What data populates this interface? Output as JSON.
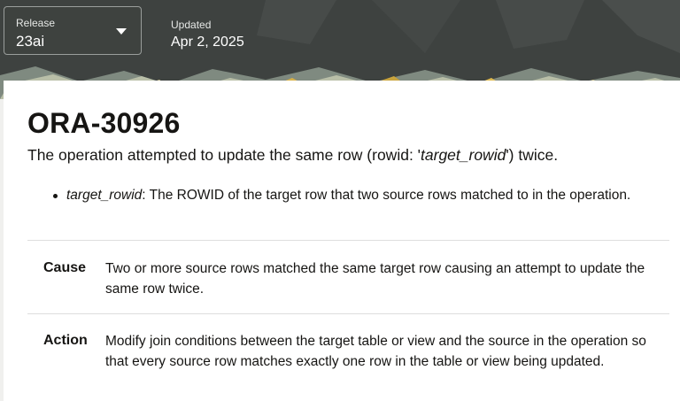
{
  "header": {
    "release_label": "Release",
    "release_value": "23ai",
    "updated_label": "Updated",
    "updated_value": "Apr 2, 2025",
    "background_color": "#3e4240"
  },
  "error": {
    "code": "ORA-30926",
    "message_before": "The operation attempted to update the same row (rowid: '",
    "message_param": "target_rowid",
    "message_after": "') twice.",
    "parameters": [
      {
        "name": "target_rowid",
        "description": ": The ROWID of the target row that two source rows matched to in the operation."
      }
    ]
  },
  "cause": {
    "label": "Cause",
    "text": "Two or more source rows matched the same target row causing an attempt to update the same row twice."
  },
  "action": {
    "label": "Action",
    "text": "Modify join conditions between the target table or view and the source in the operation so that every source row matches exactly one row in the table or view being updated."
  },
  "icons": {
    "release_dropdown": "chevron-down-icon"
  }
}
